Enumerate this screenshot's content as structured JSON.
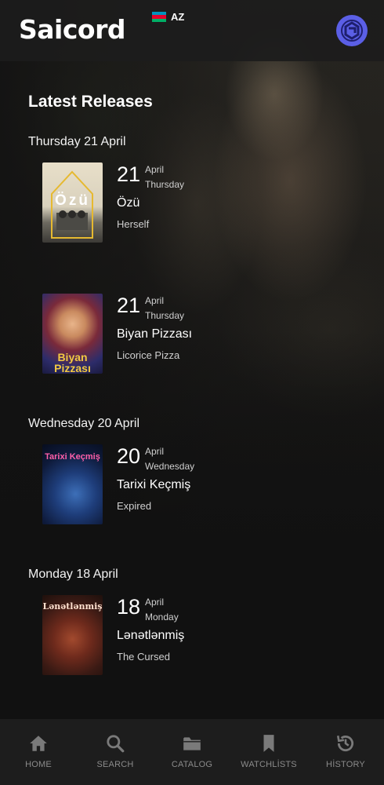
{
  "header": {
    "logo": "Saicord",
    "language_code": "AZ",
    "flag_colors": [
      "#0092bc",
      "#e4002b",
      "#00af66"
    ],
    "profile_icon": "profile-logo-icon",
    "accent": "#5b5fe6"
  },
  "main": {
    "section_title": "Latest Releases",
    "groups": [
      {
        "date_heading": "Thursday 21 April",
        "releases": [
          {
            "day": "21",
            "month": "April",
            "weekday": "Thursday",
            "title": "Özü",
            "subtitle": "Herself",
            "poster_text": "Özü"
          },
          {
            "day": "21",
            "month": "April",
            "weekday": "Thursday",
            "title": "Biyan Pizzası",
            "subtitle": "Licorice Pizza",
            "poster_text": "Biyan Pizzası"
          }
        ]
      },
      {
        "date_heading": "Wednesday 20 April",
        "releases": [
          {
            "day": "20",
            "month": "April",
            "weekday": "Wednesday",
            "title": "Tarixi Keçmiş",
            "subtitle": "Expired",
            "poster_text": "Tarixi Keçmiş"
          }
        ]
      },
      {
        "date_heading": "Monday 18 April",
        "releases": [
          {
            "day": "18",
            "month": "April",
            "weekday": "Monday",
            "title": "Lənətlənmiş",
            "subtitle": "The Cursed",
            "poster_text": "Lənətlənmiş"
          }
        ]
      }
    ]
  },
  "bottom_nav": {
    "items": [
      {
        "label": "HOME",
        "icon": "home-icon"
      },
      {
        "label": "SEARCH",
        "icon": "search-icon"
      },
      {
        "label": "CATALOG",
        "icon": "folder-icon"
      },
      {
        "label": "WATCHLİSTS",
        "icon": "bookmark-icon"
      },
      {
        "label": "HİSTORY",
        "icon": "history-icon"
      }
    ]
  }
}
